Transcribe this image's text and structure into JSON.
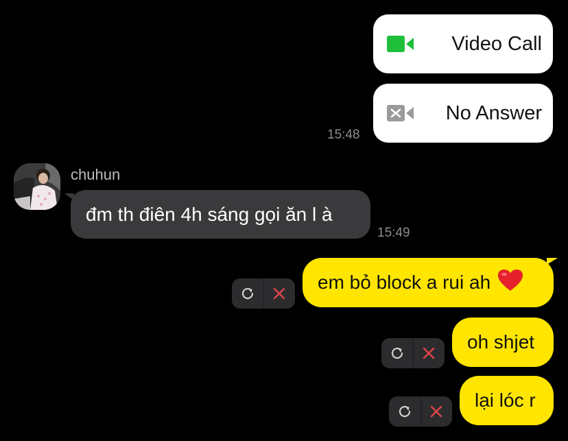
{
  "calls": [
    {
      "label": "Video Call",
      "icon": "video-camera-icon",
      "icon_color": "#1fbf3c"
    },
    {
      "label": "No Answer",
      "icon": "missed-video-camera-icon",
      "icon_color": "#9a9a9a"
    }
  ],
  "call_time": "15:48",
  "sender": {
    "name": "chuhun"
  },
  "incoming_message": {
    "text": "đm th điên 4h sáng gọi ăn l à",
    "time": "15:49"
  },
  "outgoing_messages": [
    {
      "text": "em bỏ block a rui ah",
      "emoji": "heart-emoji"
    },
    {
      "text": "oh shjet"
    },
    {
      "text": "lại lóc r"
    }
  ],
  "colors": {
    "outgoing_bubble": "#ffe500",
    "incoming_bubble": "#3a3a3c",
    "retry": "#d0d0d0",
    "delete": "#e0454a"
  }
}
